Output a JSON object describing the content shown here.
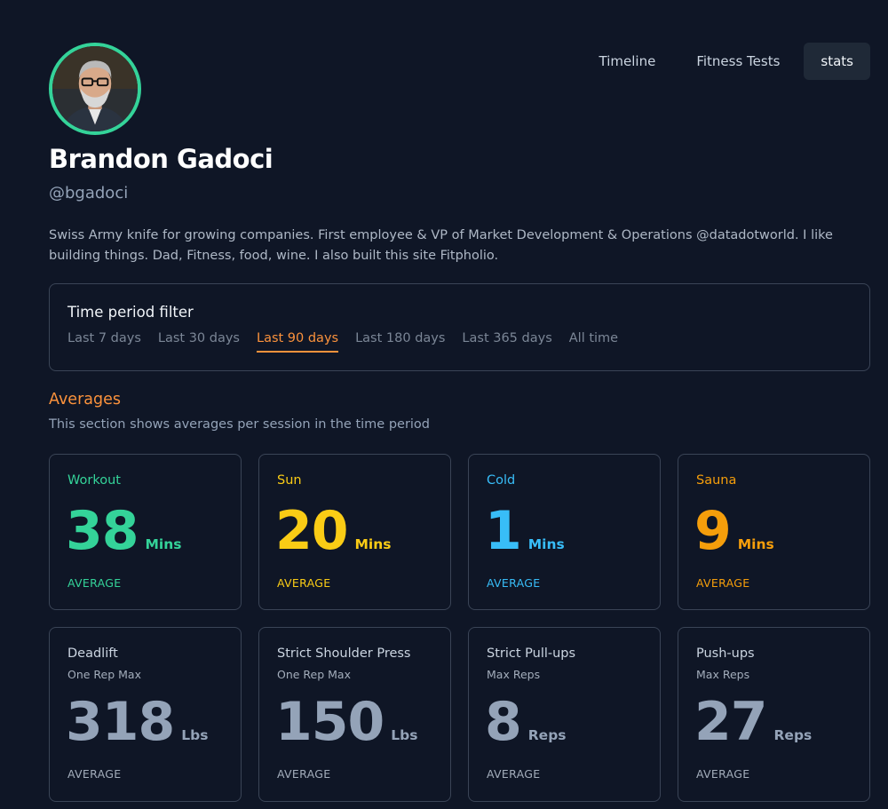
{
  "nav": {
    "tabs": [
      {
        "label": "Timeline"
      },
      {
        "label": "Fitness Tests"
      },
      {
        "label": "stats",
        "active": true
      }
    ]
  },
  "profile": {
    "name": "Brandon Gadoci",
    "handle": "@bgadoci",
    "bio": "Swiss Army knife for growing companies. First employee & VP of Market Development & Operations @datadotworld. I like building things. Dad, Fitness, food, wine. I also built this site Fitpholio.",
    "avatar_icon": "portrait-avatar"
  },
  "filter": {
    "title": "Time period filter",
    "options": [
      "Last 7 days",
      "Last 30 days",
      "Last 90 days",
      "Last 180 days",
      "Last 365 days",
      "All time"
    ],
    "selected": "Last 90 days"
  },
  "averages": {
    "title": "Averages",
    "subtitle": "This section shows averages per session in the time period",
    "sessions": [
      {
        "label": "Workout",
        "value": "38",
        "unit": "Mins",
        "foot": "AVERAGE",
        "color": "#34d399"
      },
      {
        "label": "Sun",
        "value": "20",
        "unit": "Mins",
        "foot": "AVERAGE",
        "color": "#facc15"
      },
      {
        "label": "Cold",
        "value": "1",
        "unit": "Mins",
        "foot": "AVERAGE",
        "color": "#38bdf8"
      },
      {
        "label": "Sauna",
        "value": "9",
        "unit": "Mins",
        "foot": "AVERAGE",
        "color": "#f59e0b"
      }
    ],
    "tests": [
      {
        "label": "Deadlift",
        "sub": "One Rep Max",
        "value": "318",
        "unit": "Lbs",
        "foot": "AVERAGE"
      },
      {
        "label": "Strict Shoulder Press",
        "sub": "One Rep Max",
        "value": "150",
        "unit": "Lbs",
        "foot": "AVERAGE"
      },
      {
        "label": "Strict Pull-ups",
        "sub": "Max Reps",
        "value": "8",
        "unit": "Reps",
        "foot": "AVERAGE"
      },
      {
        "label": "Push-ups",
        "sub": "Max Reps",
        "value": "27",
        "unit": "Reps",
        "foot": "AVERAGE"
      }
    ]
  },
  "colors": {
    "background": "#0f1626",
    "accent": "#fb923c",
    "avatar_ring": "#34d399"
  }
}
